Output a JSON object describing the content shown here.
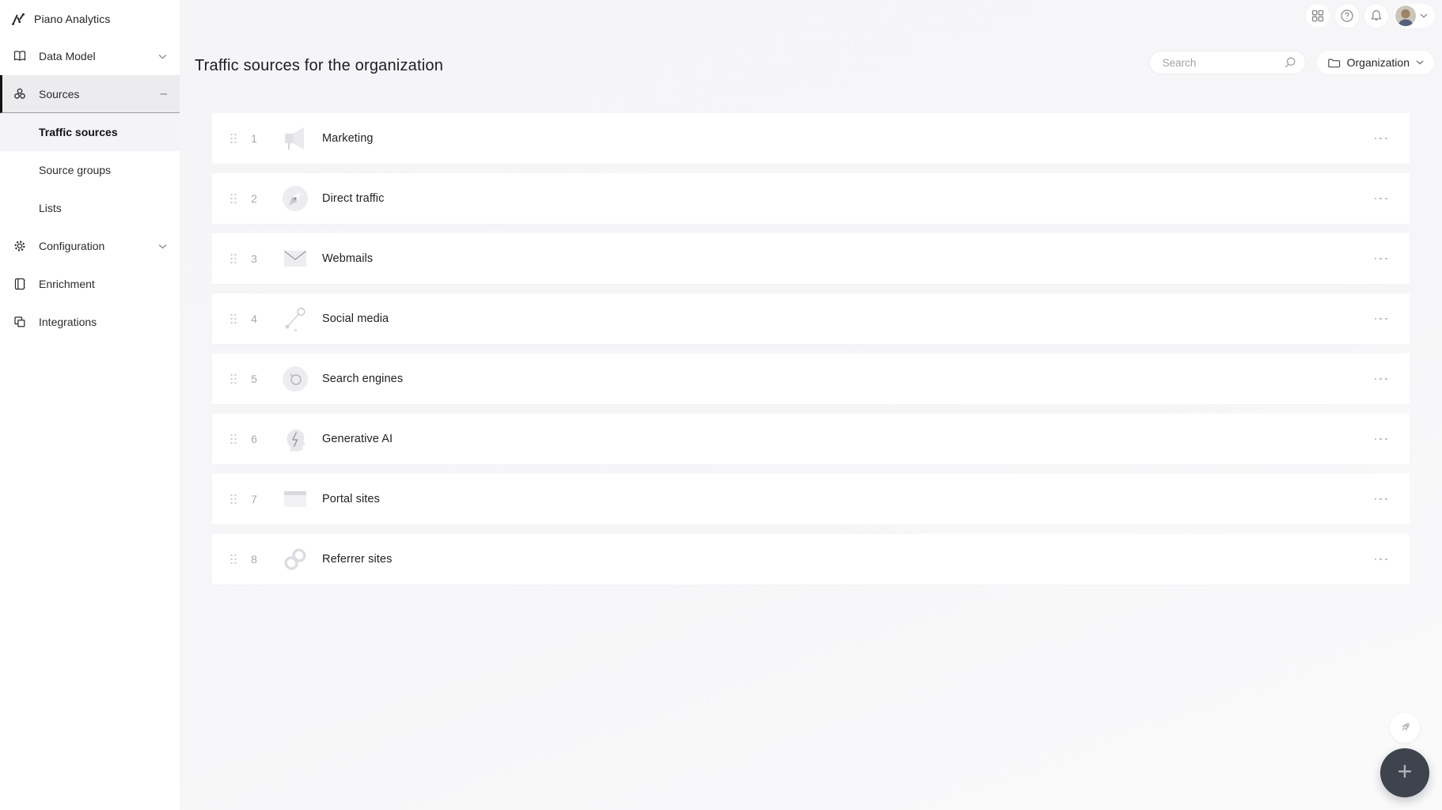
{
  "brand": {
    "name": "Piano Analytics"
  },
  "sidebar": {
    "items": [
      {
        "label": "Data Model",
        "icon": "book-icon",
        "expandable": true
      },
      {
        "label": "Sources",
        "icon": "cluster-icon",
        "expanded": true
      },
      {
        "label": "Traffic sources",
        "selected": true
      },
      {
        "label": "Source groups",
        "selected": false
      },
      {
        "label": "Lists",
        "selected": false
      },
      {
        "label": "Configuration",
        "icon": "gear-icon",
        "expandable": true
      },
      {
        "label": "Enrichment",
        "icon": "notebook-icon"
      },
      {
        "label": "Integrations",
        "icon": "overlap-squares-icon"
      }
    ]
  },
  "topbar": {
    "icons": [
      "apps-grid-icon",
      "help-icon",
      "bell-icon"
    ],
    "help_glyph": "?",
    "user_menu": {
      "avatar": "user-photo",
      "chevron": "down"
    }
  },
  "header": {
    "title": "Traffic sources for the organization",
    "search": {
      "placeholder": "Search"
    },
    "scope": {
      "label": "Organization",
      "icon": "folder-icon"
    }
  },
  "list": {
    "rows": [
      {
        "index": "1",
        "label": "Marketing",
        "icon": "megaphone-icon"
      },
      {
        "index": "2",
        "label": "Direct traffic",
        "icon": "compass-icon"
      },
      {
        "index": "3",
        "label": "Webmails",
        "icon": "envelope-icon"
      },
      {
        "index": "4",
        "label": "Social media",
        "icon": "share-nodes-icon"
      },
      {
        "index": "5",
        "label": "Search engines",
        "icon": "magnifier-icon"
      },
      {
        "index": "6",
        "label": "Generative AI",
        "icon": "ai-head-icon"
      },
      {
        "index": "7",
        "label": "Portal sites",
        "icon": "browser-window-icon"
      },
      {
        "index": "8",
        "label": "Referrer sites",
        "icon": "link-icon"
      }
    ]
  },
  "floating": {
    "rocket_button": {
      "icon": "rocket-icon"
    },
    "add_button": {
      "label": "+"
    }
  },
  "colors": {
    "page_bg": "#f5f5f7",
    "card_bg": "#ffffff",
    "sidebar_bg": "#ffffff",
    "active_item_border": "#141414",
    "active_item_bg": "#ececee",
    "selected_sub_bg": "#f4f4f6",
    "fab_bg": "#3e434d",
    "muted_text": "#a8a8af",
    "text": "#222226"
  }
}
